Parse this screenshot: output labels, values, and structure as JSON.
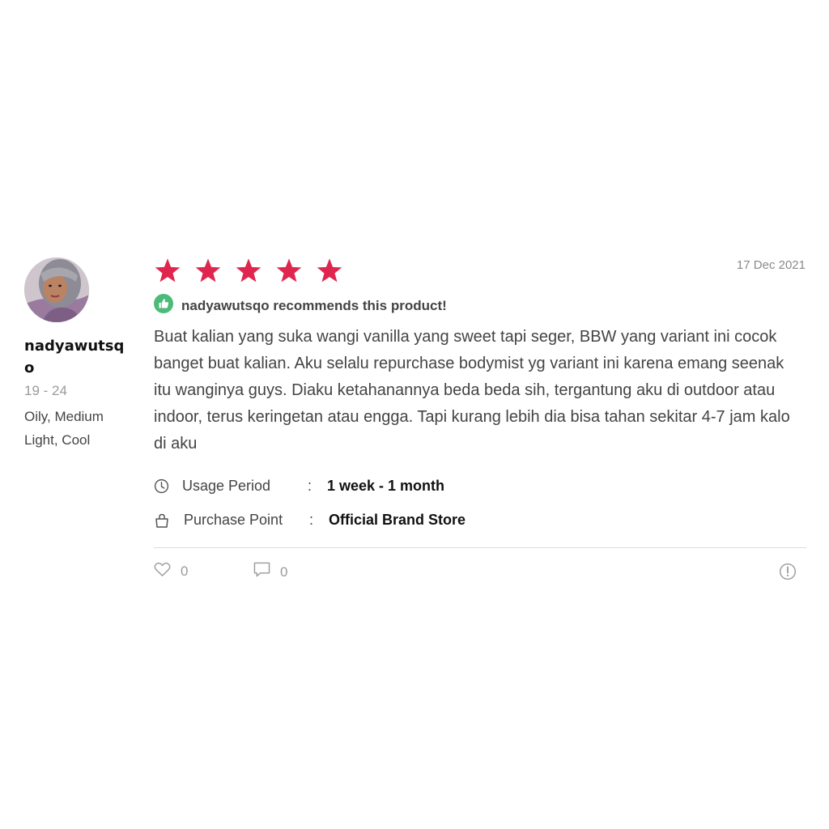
{
  "reviewer": {
    "username": "nadyawutsqo",
    "age_range": "19 - 24",
    "skin_profile": "Oily, Medium Light, Cool"
  },
  "review": {
    "rating": 5,
    "rating_max": 5,
    "star_color": "#e0264f",
    "date": "17 Dec 2021",
    "recommend_text": "nadyawutsqo recommends this product!",
    "recommend_icon": "thumbs-up-icon",
    "recommend_color": "#4cbb7a",
    "body": "Buat kalian yang suka wangi vanilla yang sweet tapi seger, BBW yang variant ini cocok banget buat kalian. Aku selalu repurchase bodymist yg variant ini karena emang seenak itu wanginya guys. Diaku ketahanannya beda beda sih, tergantung aku di outdoor atau indoor, terus keringetan atau engga. Tapi kurang lebih dia bisa tahan sekitar 4-7 jam kalo di aku"
  },
  "details": {
    "usage_period": {
      "label": "Usage Period",
      "separator": ":",
      "value": "1 week - 1 month",
      "icon": "clock-icon"
    },
    "purchase_point": {
      "label": "Purchase Point",
      "separator": ":",
      "value": "Official Brand Store",
      "icon": "shopping-bag-icon"
    }
  },
  "actions": {
    "likes": "0",
    "comments": "0",
    "like_icon": "heart-icon",
    "comment_icon": "comment-icon",
    "report_icon": "report-icon"
  }
}
